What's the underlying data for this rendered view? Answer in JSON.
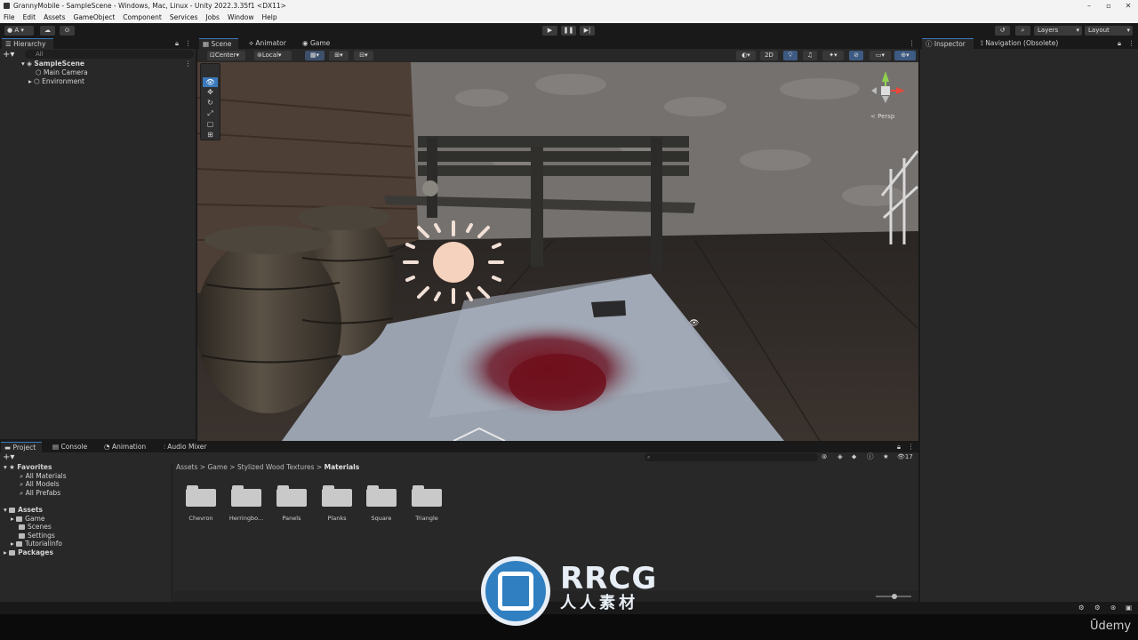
{
  "window": {
    "title": "GrannyMobile - SampleScene - Windows, Mac, Linux - Unity 2022.3.35f1 <DX11>"
  },
  "menu": [
    "File",
    "Edit",
    "Assets",
    "GameObject",
    "Component",
    "Services",
    "Jobs",
    "Window",
    "Help"
  ],
  "toolbar": {
    "account": "A",
    "layers": "Layers",
    "layout": "Layout"
  },
  "hierarchy": {
    "tab": "Hierarchy",
    "search_placeholder": "All",
    "scene": "SampleScene",
    "items": [
      "Main Camera",
      "Environment"
    ]
  },
  "scene_tabs": [
    "Scene",
    "Animator",
    "Game"
  ],
  "scene_toolbar": {
    "pivot": "Center",
    "space": "Local",
    "mode_2d": "2D"
  },
  "gizmo": {
    "projection": "Persp"
  },
  "inspector": {
    "tabs": [
      "Inspector",
      "Navigation (Obsolete)"
    ]
  },
  "bottom_tabs": [
    "Project",
    "Console",
    "Animation",
    "Audio Mixer"
  ],
  "project": {
    "favorites": {
      "label": "Favorites",
      "items": [
        "All Materials",
        "All Models",
        "All Prefabs"
      ]
    },
    "assets": {
      "label": "Assets",
      "items": [
        "Game",
        "Scenes",
        "Settings",
        "TutorialInfo"
      ]
    },
    "packages": "Packages",
    "breadcrumb": [
      "Assets",
      "Game",
      "Stylized Wood Textures",
      "Materials"
    ],
    "folders": [
      "Chevron",
      "Herringbo...",
      "Panels",
      "Planks",
      "Square",
      "Triangle"
    ],
    "hidden_count": "17"
  },
  "watermark": {
    "brand": "RRCG",
    "sub": "人人素材"
  },
  "udemy": "Ūdemy",
  "colors": {
    "accent": "#3a79bb",
    "panel": "#282828",
    "chrome": "#191919",
    "blood": "#7a0f1c"
  }
}
